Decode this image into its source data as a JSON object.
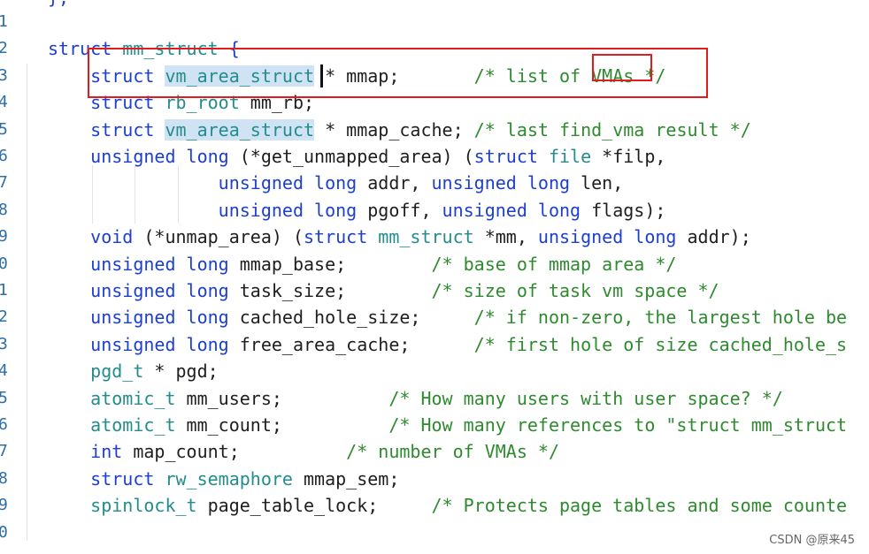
{
  "editor": {
    "line_numbers": [
      "1",
      "2",
      "3",
      "4",
      "5",
      "6",
      "7",
      "8",
      "9",
      "0",
      "1",
      "2",
      "3",
      "4",
      "5",
      "6",
      "7",
      "8",
      "9",
      "0"
    ],
    "top_fragment": "};",
    "lines": [
      {
        "tokens": []
      },
      {
        "tokens": [
          {
            "t": "struct",
            "c": "kw"
          },
          {
            "t": " ",
            "c": "pl"
          },
          {
            "t": "mm_struct",
            "c": "ty"
          },
          {
            "t": " {",
            "c": "kw"
          }
        ]
      },
      {
        "tokens": [
          {
            "t": "    struct",
            "c": "kw"
          },
          {
            "t": " ",
            "c": "pl"
          },
          {
            "t": "vm_area_struct",
            "c": "ty",
            "hl": true
          },
          {
            "t": " * mmap;       ",
            "c": "pl"
          },
          {
            "t": "/* list of VMAs */",
            "c": "cm"
          }
        ]
      },
      {
        "tokens": [
          {
            "t": "    struct",
            "c": "kw"
          },
          {
            "t": " ",
            "c": "pl"
          },
          {
            "t": "rb_root",
            "c": "ty"
          },
          {
            "t": " mm_rb;",
            "c": "pl"
          }
        ]
      },
      {
        "tokens": [
          {
            "t": "    struct",
            "c": "kw"
          },
          {
            "t": " ",
            "c": "pl"
          },
          {
            "t": "vm_area_struct",
            "c": "ty",
            "hl": true
          },
          {
            "t": " * mmap_cache; ",
            "c": "pl"
          },
          {
            "t": "/* last find_vma result */",
            "c": "cm"
          }
        ]
      },
      {
        "tokens": [
          {
            "t": "    unsigned long",
            "c": "kw"
          },
          {
            "t": " (*get_unmapped_area) (",
            "c": "pl"
          },
          {
            "t": "struct",
            "c": "kw"
          },
          {
            "t": " ",
            "c": "pl"
          },
          {
            "t": "file",
            "c": "ty"
          },
          {
            "t": " *filp,",
            "c": "pl"
          }
        ]
      },
      {
        "tokens": [
          {
            "t": "                unsigned long",
            "c": "kw"
          },
          {
            "t": " addr, ",
            "c": "pl"
          },
          {
            "t": "unsigned long",
            "c": "kw"
          },
          {
            "t": " len,",
            "c": "pl"
          }
        ]
      },
      {
        "tokens": [
          {
            "t": "                unsigned long",
            "c": "kw"
          },
          {
            "t": " pgoff, ",
            "c": "pl"
          },
          {
            "t": "unsigned long",
            "c": "kw"
          },
          {
            "t": " flags);",
            "c": "pl"
          }
        ]
      },
      {
        "tokens": [
          {
            "t": "    void",
            "c": "kw"
          },
          {
            "t": " (*unmap_area) (",
            "c": "pl"
          },
          {
            "t": "struct",
            "c": "kw"
          },
          {
            "t": " ",
            "c": "pl"
          },
          {
            "t": "mm_struct",
            "c": "ty"
          },
          {
            "t": " *mm, ",
            "c": "pl"
          },
          {
            "t": "unsigned long",
            "c": "kw"
          },
          {
            "t": " addr);",
            "c": "pl"
          }
        ]
      },
      {
        "tokens": [
          {
            "t": "    unsigned long",
            "c": "kw"
          },
          {
            "t": " mmap_base;        ",
            "c": "pl"
          },
          {
            "t": "/* base of mmap area */",
            "c": "cm"
          }
        ]
      },
      {
        "tokens": [
          {
            "t": "    unsigned long",
            "c": "kw"
          },
          {
            "t": " task_size;        ",
            "c": "pl"
          },
          {
            "t": "/* size of task vm space */",
            "c": "cm"
          }
        ]
      },
      {
        "tokens": [
          {
            "t": "    unsigned long",
            "c": "kw"
          },
          {
            "t": " cached_hole_size;     ",
            "c": "pl"
          },
          {
            "t": "/* if non-zero, the largest hole be",
            "c": "cm"
          }
        ]
      },
      {
        "tokens": [
          {
            "t": "    unsigned long",
            "c": "kw"
          },
          {
            "t": " free_area_cache;      ",
            "c": "pl"
          },
          {
            "t": "/* first hole of size cached_hole_s",
            "c": "cm"
          }
        ]
      },
      {
        "tokens": [
          {
            "t": "    pgd_t",
            "c": "ty"
          },
          {
            "t": " * pgd;",
            "c": "pl"
          }
        ]
      },
      {
        "tokens": [
          {
            "t": "    atomic_t",
            "c": "ty"
          },
          {
            "t": " mm_users;          ",
            "c": "pl"
          },
          {
            "t": "/* How many users with user space? */",
            "c": "cm"
          }
        ]
      },
      {
        "tokens": [
          {
            "t": "    atomic_t",
            "c": "ty"
          },
          {
            "t": " mm_count;          ",
            "c": "pl"
          },
          {
            "t": "/* How many references to \"struct mm_struct",
            "c": "cm"
          }
        ]
      },
      {
        "tokens": [
          {
            "t": "    int",
            "c": "kw"
          },
          {
            "t": " map_count;          ",
            "c": "pl"
          },
          {
            "t": "/* number of VMAs */",
            "c": "cm"
          }
        ]
      },
      {
        "tokens": [
          {
            "t": "    struct",
            "c": "kw"
          },
          {
            "t": " ",
            "c": "pl"
          },
          {
            "t": "rw_semaphore",
            "c": "ty"
          },
          {
            "t": " mmap_sem;",
            "c": "pl"
          }
        ]
      },
      {
        "tokens": [
          {
            "t": "    spinlock_t",
            "c": "ty"
          },
          {
            "t": " page_table_lock;     ",
            "c": "pl"
          },
          {
            "t": "/* Protects page tables and some counte",
            "c": "cm"
          }
        ]
      },
      {
        "tokens": []
      }
    ]
  },
  "watermark": "CSDN @原来45"
}
